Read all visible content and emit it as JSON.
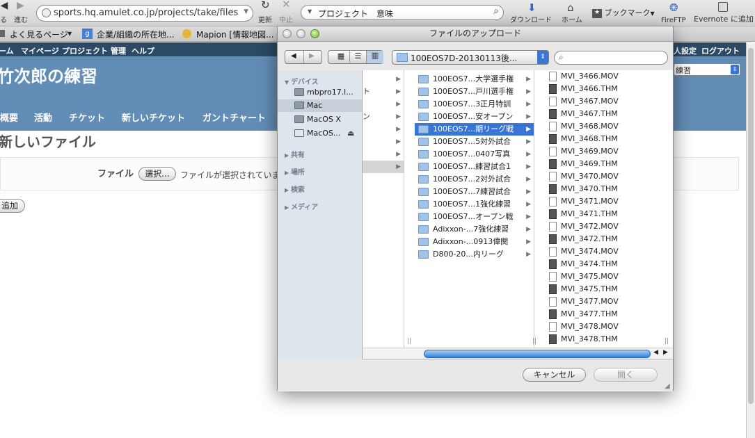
{
  "browser": {
    "back_label": "る",
    "forward_label": "進む",
    "url": "sports.hq.amulet.co.jp/projects/take/files",
    "reload_label": "更新",
    "stop_label": "中止",
    "search_text": "プロジェクト　意味",
    "download_label": "ダウンロード",
    "home_label": "ホーム",
    "bookmark_label": "ブックマーク",
    "fireftp_label": "FireFTP",
    "evernote_label": "Evernote に追加"
  },
  "bookmarks": [
    "よく見るページ",
    "企業/組織の所在地...",
    "Mapion [情報地図..."
  ],
  "site": {
    "top_menu": [
      "ーム",
      "マイページ",
      "プロジェクト",
      "管理",
      "ヘルプ"
    ],
    "top_right": [
      "人設定",
      "ログアウト"
    ],
    "project_select": "練習",
    "title": "竹次郎の練習",
    "main_menu": [
      "概要",
      "活動",
      "チケット",
      "新しいチケット",
      "ガントチャート"
    ],
    "page_title": "新しいファイル",
    "file_label": "ファイル",
    "choose_button": "選択...",
    "no_file_text": "ファイルが選択されていま",
    "add_button": "追加"
  },
  "dialog": {
    "title": "ファイルのアップロード",
    "path_popup": "100EOS7D-20130113後...",
    "search_placeholder": "",
    "sidebar": {
      "devices_header": "デバイス",
      "devices": [
        "mbpro17.l...",
        "Mac",
        "MacOS X",
        "MacOS..."
      ],
      "selected_device": 1,
      "sections": [
        "共有",
        "場所",
        "検索",
        "メディア"
      ]
    },
    "col1": [
      "ト",
      "ン"
    ],
    "folders": [
      "100EOS7...大学選手権",
      "100EOS7...戸川選手権",
      "100EOS7...3正月特訓",
      "100EOS7...安オープン",
      "100EOS7...期リーグ戦",
      "100EOS7...5対外試合",
      "100EOS7...0407写真",
      "100EOS7...練習試合1",
      "100EOS7...2対外試合",
      "100EOS7...7練習試合",
      "100EOS7...1強化練習",
      "100EOS7...オープン戦",
      "Adixxon-...7強化練習",
      "Adixxon-...0913偉関",
      "D800-20...内リーグ"
    ],
    "selected_folder": 4,
    "files": [
      "MVI_3466.MOV",
      "MVI_3466.THM",
      "MVI_3467.MOV",
      "MVI_3467.THM",
      "MVI_3468.MOV",
      "MVI_3468.THM",
      "MVI_3469.MOV",
      "MVI_3469.THM",
      "MVI_3470.MOV",
      "MVI_3470.THM",
      "MVI_3471.MOV",
      "MVI_3471.THM",
      "MVI_3472.MOV",
      "MVI_3472.THM",
      "MVI_3474.MOV",
      "MVI_3474.THM",
      "MVI_3475.MOV",
      "MVI_3475.THM",
      "MVI_3477.MOV",
      "MVI_3477.THM",
      "MVI_3478.MOV",
      "MVI_3478.THM"
    ],
    "cancel_button": "キャンセル",
    "open_button": "開く"
  }
}
